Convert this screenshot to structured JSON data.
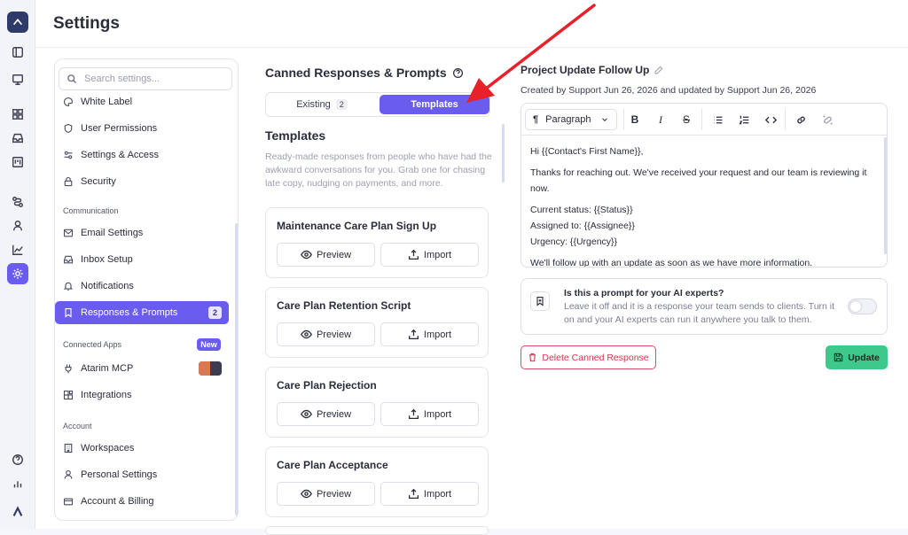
{
  "page": {
    "title": "Settings"
  },
  "colors": {
    "accent": "#6b5cf0",
    "success": "#3ec98a",
    "danger": "#d8324f",
    "annotation_arrow": "#e8202a"
  },
  "rail": {
    "top_icons": [
      "sidebar-toggle-icon",
      "computer-icon",
      "grid-icon",
      "inbox-icon",
      "board-icon",
      "route-icon",
      "user-icon",
      "chart-icon",
      "gear-icon"
    ],
    "bottom_icons": [
      "help-icon",
      "bar-chart-icon",
      "brand-icon"
    ],
    "active": "gear-icon"
  },
  "sidebar": {
    "search_placeholder": "Search settings...",
    "items_top": [
      {
        "label": "White Label",
        "icon": "palette-icon"
      },
      {
        "label": "User Permissions",
        "icon": "shield-icon"
      },
      {
        "label": "Settings & Access",
        "icon": "sliders-icon"
      },
      {
        "label": "Security",
        "icon": "lock-icon"
      }
    ],
    "section_communication": "Communication",
    "items_comm": [
      {
        "label": "Email Settings",
        "icon": "mail-icon"
      },
      {
        "label": "Inbox Setup",
        "icon": "inbox-icon"
      },
      {
        "label": "Notifications",
        "icon": "bell-icon"
      },
      {
        "label": "Responses & Prompts",
        "icon": "bookmark-icon",
        "count": "2",
        "active": true
      }
    ],
    "section_apps": "Connected Apps",
    "new_badge": "New",
    "items_apps": [
      {
        "label": "Atarim MCP",
        "icon": "plug-icon"
      },
      {
        "label": "Integrations",
        "icon": "puzzle-icon"
      }
    ],
    "section_account": "Account",
    "items_account": [
      {
        "label": "Workspaces",
        "icon": "building-icon"
      },
      {
        "label": "Personal Settings",
        "icon": "person-icon"
      },
      {
        "label": "Account & Billing",
        "icon": "card-icon"
      }
    ]
  },
  "canned": {
    "heading": "Canned Responses & Prompts",
    "tab_existing": "Existing",
    "tab_existing_count": "2",
    "tab_templates": "Templates",
    "templates_heading": "Templates",
    "templates_desc": "Ready-made responses from people who have had the awkward conversations for you. Grab one for chasing late copy, nudging on payments, and more.",
    "preview_label": "Preview",
    "import_label": "Import",
    "cards": [
      {
        "title": "Maintenance Care Plan Sign Up"
      },
      {
        "title": "Care Plan Retention Script"
      },
      {
        "title": "Care Plan Rejection"
      },
      {
        "title": "Care Plan Acceptance"
      }
    ]
  },
  "detail": {
    "title": "Project Update Follow Up",
    "meta": "Created by Support Jun 26, 2026 and updated by Support Jun 26, 2026",
    "paragraph_pilcrow": "¶",
    "paragraph_select": "Paragraph",
    "toolbar": {
      "bold": "B",
      "italic": "I",
      "strike": "S"
    },
    "body": {
      "greeting": "Hi {{Contact's First Name}},",
      "line1": "Thanks for reaching out. We've received your request and our team is reviewing it now.",
      "status": "Current status: {{Status}}",
      "assigned": "Assigned to: {{Assignee}}",
      "urgency": "Urgency: {{Urgency}}",
      "followup": "We'll follow up with an update as soon as we have more information."
    },
    "ai": {
      "question": "Is this a prompt for your AI experts?",
      "description": "Leave it off and it is a response your team sends to clients. Turn it on and your AI experts can run it anywhere you talk to them.",
      "enabled": false
    },
    "delete_label": "Delete Canned Response",
    "update_label": "Update"
  }
}
